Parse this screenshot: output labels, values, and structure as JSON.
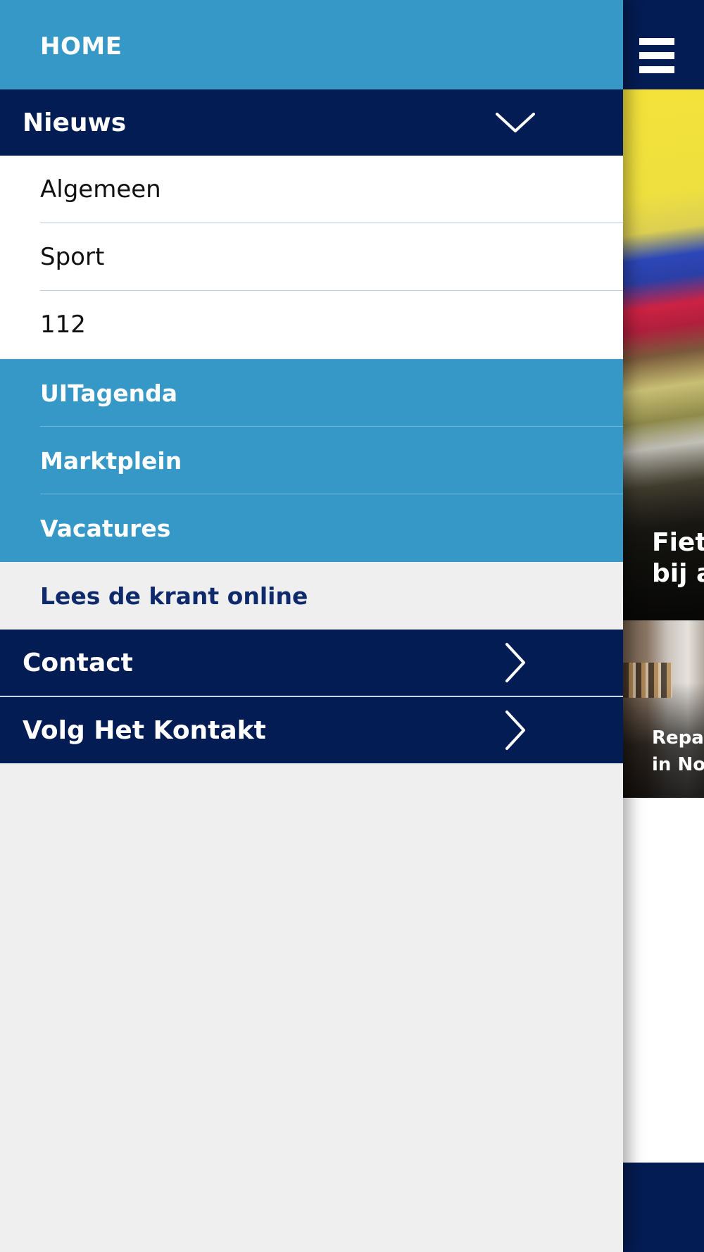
{
  "main_page": {
    "hero_article": {
      "title_lines": [
        "Fiets",
        "bij a"
      ]
    },
    "second_article": {
      "title_lines": [
        "Repai",
        "in No"
      ]
    }
  },
  "drawer": {
    "home_label": "HOME",
    "nieuws": {
      "label": "Nieuws",
      "expanded": true,
      "items": [
        {
          "label": "Algemeen"
        },
        {
          "label": "Sport"
        },
        {
          "label": "112"
        }
      ]
    },
    "blue_items": [
      {
        "label": "UITagenda"
      },
      {
        "label": "Marktplein"
      },
      {
        "label": "Vacatures"
      }
    ],
    "krant_label": "Lees de krant online",
    "contact_label": "Contact",
    "volg_label": "Volg Het Kontakt"
  },
  "colors": {
    "navy": "#041c54",
    "light_blue": "#3598c6",
    "drawer_background": "#efeff0",
    "krant_text": "#0f2a6b"
  },
  "icons": {
    "menu": "hamburger-icon",
    "nieuws_toggle": "chevron-down-icon",
    "contact_arrow": "chevron-right-icon",
    "volg_arrow": "chevron-right-icon"
  }
}
